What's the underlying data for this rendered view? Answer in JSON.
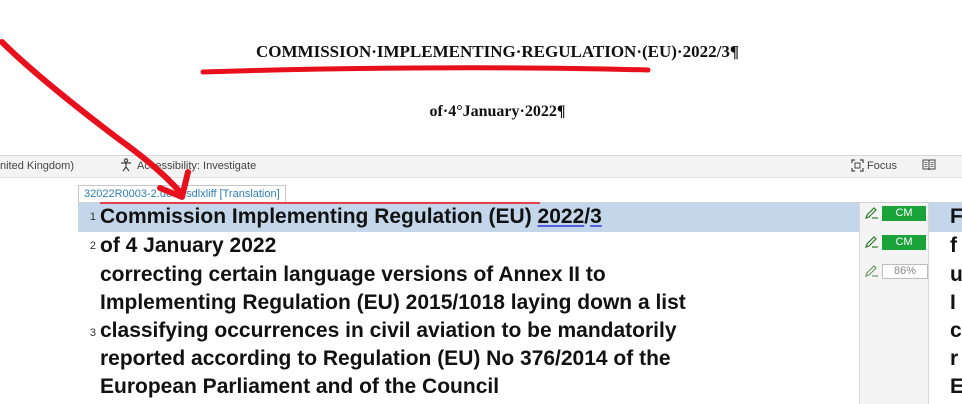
{
  "document": {
    "title": "COMMISSION·IMPLEMENTING·REGULATION·(EU)·2022/3¶",
    "date": "of·4°January·2022¶"
  },
  "statusbar": {
    "language": "nited Kingdom)",
    "accessibility": "Accessibility: Investigate",
    "focus": "Focus"
  },
  "file_tab": "32022R0003-2.docx.sdlxliff [Translation]",
  "segments": [
    {
      "number": "1",
      "source_lines": [
        "Commission Implementing Regulation (EU) 2022/3"
      ],
      "status": "CM",
      "target_start": "F"
    },
    {
      "number": "2",
      "source_lines": [
        "of 4 January 2022"
      ],
      "status": "CM",
      "target_start": "f"
    },
    {
      "number": "3",
      "source_lines": [
        "correcting certain language versions of Annex II to",
        "Implementing Regulation (EU) 2015/1018 laying down a list",
        "classifying occurrences in civil aviation to be mandatorily",
        "reported according to Regulation (EU) No 376/2014 of the",
        "European Parliament and of the Council"
      ],
      "status": "86%",
      "target_lines": [
        "u",
        "I",
        "c",
        "r",
        "E"
      ]
    }
  ],
  "colors": {
    "selected_row": "#c4d7ea",
    "cm_badge": "#1aa339",
    "annotation": "#e8101c"
  }
}
